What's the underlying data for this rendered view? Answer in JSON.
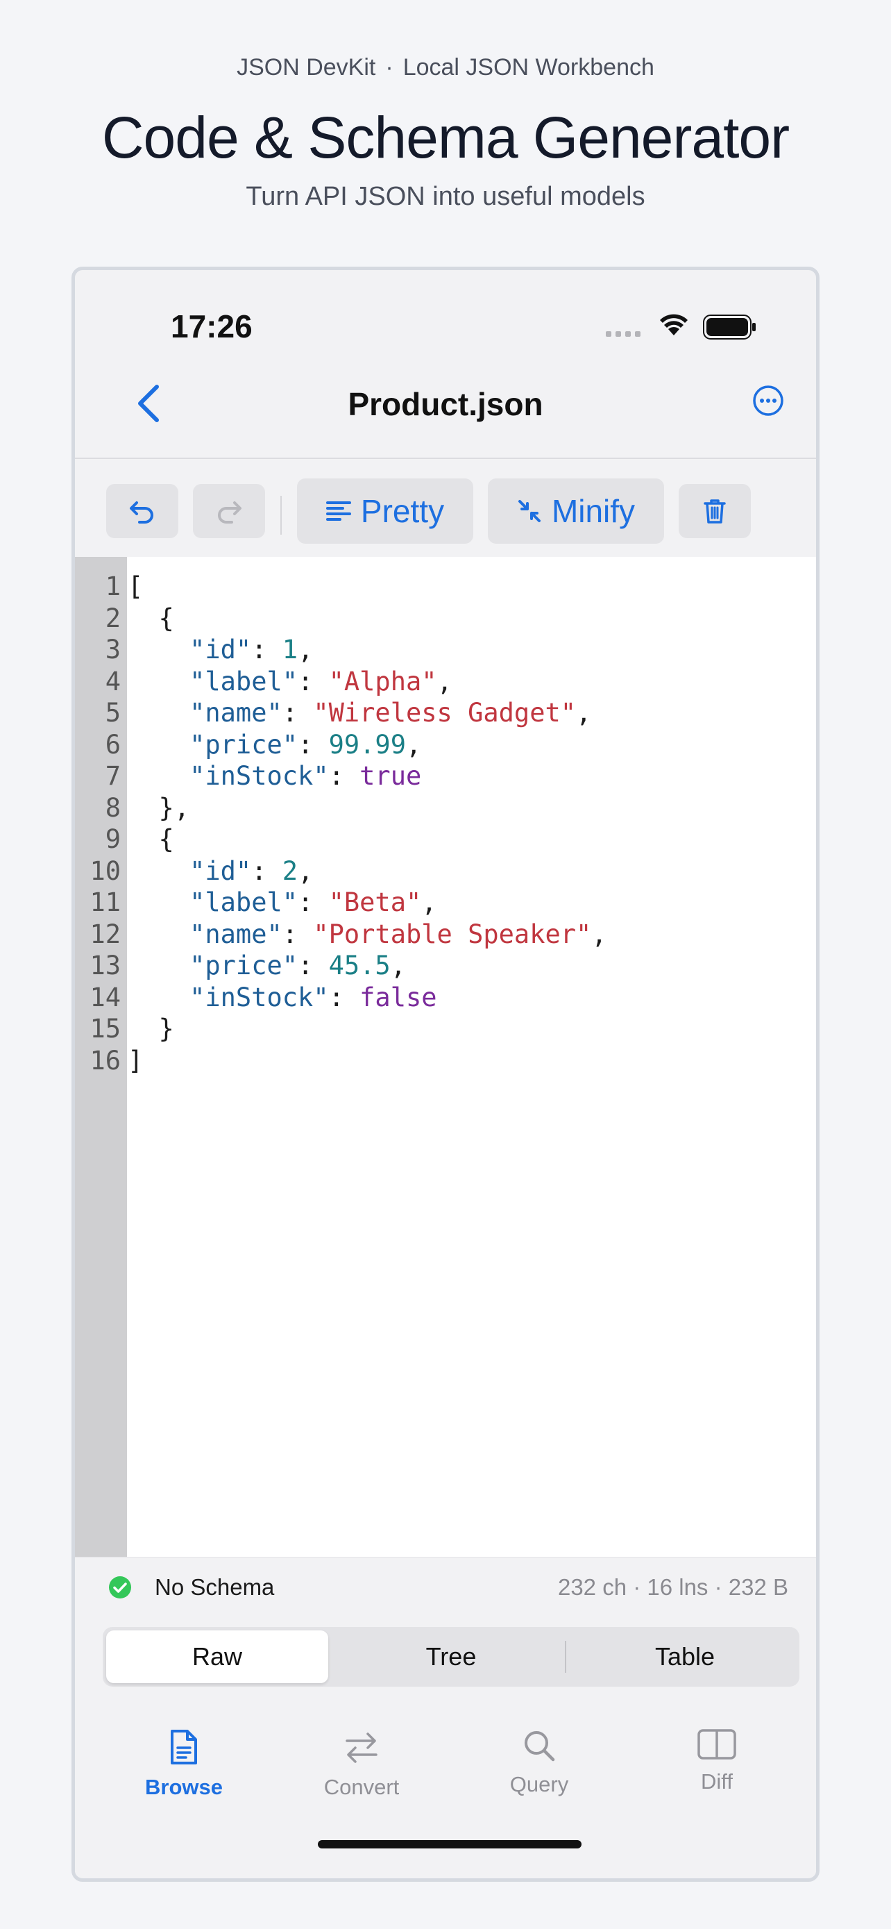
{
  "page": {
    "app_name": "JSON DevKit",
    "separator": "·",
    "app_tagline": "Local JSON Workbench",
    "headline": "Code & Schema Generator",
    "subheadline": "Turn API JSON into useful models"
  },
  "status_bar": {
    "time": "17:26"
  },
  "nav": {
    "title": "Product.json"
  },
  "toolbar": {
    "pretty_label": "Pretty",
    "minify_label": "Minify"
  },
  "editor": {
    "line_numbers": [
      "1",
      "2",
      "3",
      "4",
      "5",
      "6",
      "7",
      "8",
      "9",
      "10",
      "11",
      "12",
      "13",
      "14",
      "15",
      "16"
    ],
    "lines": [
      [
        {
          "t": "p",
          "v": "["
        }
      ],
      [
        {
          "t": "p",
          "v": "  {"
        }
      ],
      [
        {
          "t": "p",
          "v": "    "
        },
        {
          "t": "k",
          "v": "\"id\""
        },
        {
          "t": "p",
          "v": ": "
        },
        {
          "t": "n",
          "v": "1"
        },
        {
          "t": "p",
          "v": ","
        }
      ],
      [
        {
          "t": "p",
          "v": "    "
        },
        {
          "t": "k",
          "v": "\"label\""
        },
        {
          "t": "p",
          "v": ": "
        },
        {
          "t": "s",
          "v": "\"Alpha\""
        },
        {
          "t": "p",
          "v": ","
        }
      ],
      [
        {
          "t": "p",
          "v": "    "
        },
        {
          "t": "k",
          "v": "\"name\""
        },
        {
          "t": "p",
          "v": ": "
        },
        {
          "t": "s",
          "v": "\"Wireless Gadget\""
        },
        {
          "t": "p",
          "v": ","
        }
      ],
      [
        {
          "t": "p",
          "v": "    "
        },
        {
          "t": "k",
          "v": "\"price\""
        },
        {
          "t": "p",
          "v": ": "
        },
        {
          "t": "n",
          "v": "99.99"
        },
        {
          "t": "p",
          "v": ","
        }
      ],
      [
        {
          "t": "p",
          "v": "    "
        },
        {
          "t": "k",
          "v": "\"inStock\""
        },
        {
          "t": "p",
          "v": ": "
        },
        {
          "t": "b",
          "v": "true"
        }
      ],
      [
        {
          "t": "p",
          "v": "  },"
        }
      ],
      [
        {
          "t": "p",
          "v": "  {"
        }
      ],
      [
        {
          "t": "p",
          "v": "    "
        },
        {
          "t": "k",
          "v": "\"id\""
        },
        {
          "t": "p",
          "v": ": "
        },
        {
          "t": "n",
          "v": "2"
        },
        {
          "t": "p",
          "v": ","
        }
      ],
      [
        {
          "t": "p",
          "v": "    "
        },
        {
          "t": "k",
          "v": "\"label\""
        },
        {
          "t": "p",
          "v": ": "
        },
        {
          "t": "s",
          "v": "\"Beta\""
        },
        {
          "t": "p",
          "v": ","
        }
      ],
      [
        {
          "t": "p",
          "v": "    "
        },
        {
          "t": "k",
          "v": "\"name\""
        },
        {
          "t": "p",
          "v": ": "
        },
        {
          "t": "s",
          "v": "\"Portable Speaker\""
        },
        {
          "t": "p",
          "v": ","
        }
      ],
      [
        {
          "t": "p",
          "v": "    "
        },
        {
          "t": "k",
          "v": "\"price\""
        },
        {
          "t": "p",
          "v": ": "
        },
        {
          "t": "n",
          "v": "45.5"
        },
        {
          "t": "p",
          "v": ","
        }
      ],
      [
        {
          "t": "p",
          "v": "    "
        },
        {
          "t": "k",
          "v": "\"inStock\""
        },
        {
          "t": "p",
          "v": ": "
        },
        {
          "t": "b",
          "v": "false"
        }
      ],
      [
        {
          "t": "p",
          "v": "  }"
        }
      ],
      [
        {
          "t": "p",
          "v": "]"
        }
      ]
    ]
  },
  "schema_bar": {
    "status": "No Schema",
    "stats": "232 ch · 16 lns · 232 B"
  },
  "segments": [
    "Raw",
    "Tree",
    "Table"
  ],
  "selected_segment": "Raw",
  "tabs": [
    {
      "label": "Browse",
      "icon": "document-icon",
      "active": true
    },
    {
      "label": "Convert",
      "icon": "arrows-left-right-icon",
      "active": false
    },
    {
      "label": "Query",
      "icon": "search-icon",
      "active": false
    },
    {
      "label": "Diff",
      "icon": "split-columns-icon",
      "active": false
    }
  ],
  "colors": {
    "accent": "#1d6fe0",
    "key": "#1f5e96",
    "string": "#c0363f",
    "number": "#1a7f86",
    "boolean": "#7a2b9b",
    "success": "#34c759"
  }
}
